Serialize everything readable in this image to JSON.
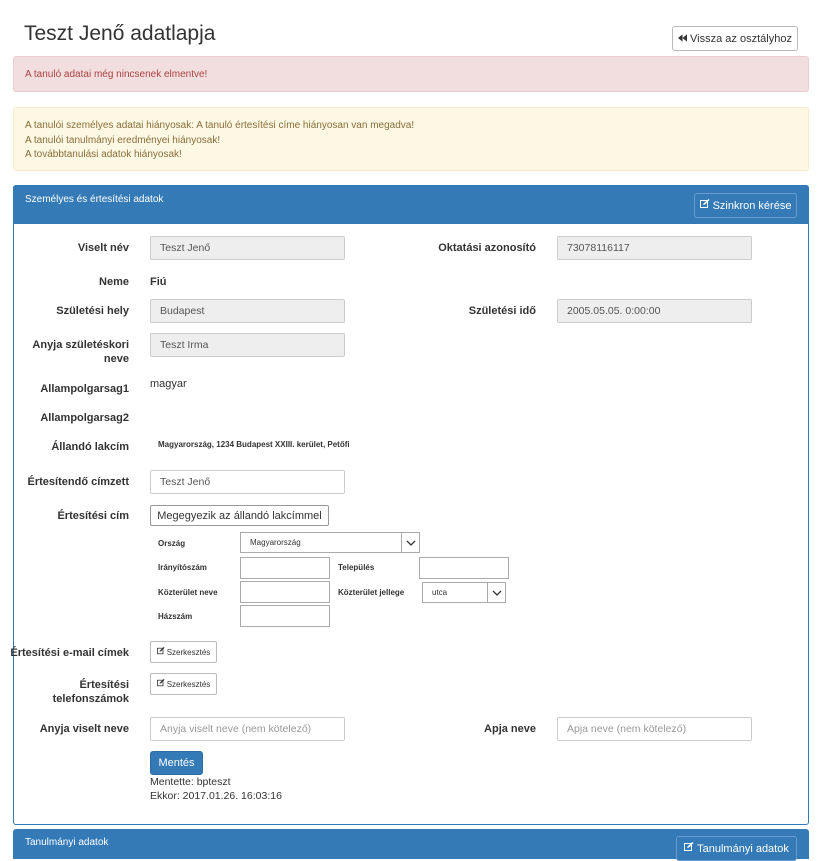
{
  "page": {
    "title": "Teszt Jenő adatlapja",
    "back_button": "Vissza az osztályhoz",
    "back_icon": "fast-backward-icon"
  },
  "alerts": {
    "danger": "A tanuló adatai még nincsenek elmentve!",
    "warnings": [
      "A tanulói személyes adatai hiányosak: A tanuló értesítési címe hiányosan van megadva!",
      "A tanulói tanulmányi eredményei hiányosak!",
      "A továbbtanulási adatok hiányosak!"
    ]
  },
  "personal_panel": {
    "title": "Személyes és értesítési adatok",
    "sync_button": "Szinkron kérése",
    "fields": {
      "viselt_nev": {
        "label": "Viselt név",
        "value": "Teszt Jenő"
      },
      "oktatasi_azonosito": {
        "label": "Oktatási azonosító",
        "value": "73078116117"
      },
      "neme": {
        "label": "Neme",
        "value": "Fiú"
      },
      "szuletesi_hely": {
        "label": "Születési hely",
        "value": "Budapest"
      },
      "szuletesi_ido": {
        "label": "Születési idő",
        "value": "2005.05.05. 0:00:00"
      },
      "anyja_szuletesi_neve": {
        "label": "Anyja születéskori neve",
        "value": "Teszt Irma"
      },
      "allampolgarsag1": {
        "label": "Allampolgarsag1",
        "value": "magyar"
      },
      "allampolgarsag2": {
        "label": "Allampolgarsag2",
        "value": ""
      },
      "allando_lakcim": {
        "label": "Állandó lakcím",
        "value": "Magyarország, 1234 Budapest XXIII. kerület, Petőfi"
      },
      "ertesitendo_cimzett": {
        "label": "Értesítendő címzett",
        "value": "Teszt Jenő"
      },
      "ertesitesi_cim": {
        "label": "Értesítési cím",
        "button": "Megegyezik az állandó lakcímmel"
      }
    },
    "address": {
      "orszag_label": "Ország",
      "orszag_value": "Magyarország",
      "iranyitoszam_label": "Irányítószám",
      "telepules_label": "Település",
      "kozterulet_neve_label": "Közterület neve",
      "kozterulet_jellege_label": "Közterület jellege",
      "kozterulet_jellege_value": "utca",
      "hazszam_label": "Házszám"
    },
    "email": {
      "label": "Értesítési e-mail címek",
      "button": "Szerkesztés"
    },
    "phones": {
      "label": "Értesítési telefonszámok",
      "button": "Szerkesztés"
    },
    "anyja_viselt_neve": {
      "label": "Anyja viselt neve",
      "placeholder": "Anyja viselt neve (nem kötelező)"
    },
    "apja_neve": {
      "label": "Apja neve",
      "placeholder": "Apja neve  (nem kötelező)"
    },
    "save_button": "Mentés",
    "saved_by": "Mentette: bpteszt",
    "saved_at": "Ekkor: 2017.01.26. 16:03:16"
  },
  "study_panel": {
    "title": "Tanulmányi adatok",
    "button": "Tanulmányi adatok"
  },
  "colors": {
    "primary": "#337ab7",
    "danger_bg": "#f2dede",
    "warning_bg": "#fcf8e3"
  }
}
